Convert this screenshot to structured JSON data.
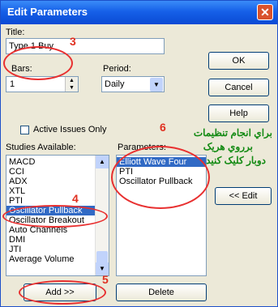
{
  "window": {
    "title": "Edit Parameters",
    "close_glyph": "✕"
  },
  "labels": {
    "title": "Title:",
    "bars": "Bars:",
    "period": "Period:",
    "active_issues": "Active Issues Only",
    "studies_available": "Studies Available:",
    "parameters": "Parameters:"
  },
  "fields": {
    "title_value": "Type 1 Buy",
    "bars_value": "1",
    "period_value": "Daily"
  },
  "buttons": {
    "ok": "OK",
    "cancel": "Cancel",
    "help": "Help",
    "edit": "<< Edit",
    "add": "Add >>",
    "delete": "Delete"
  },
  "studies": [
    "MACD",
    "CCI",
    "ADX",
    "XTL",
    "PTI",
    "Oscillator Pullback",
    "Oscillator Breakout",
    "Auto Channels",
    "DMI",
    "JTI",
    "Average Volume"
  ],
  "parameters": [
    "Elliott Wave Four",
    "PTI",
    "Oscillator Pullback"
  ],
  "annotations": {
    "n3": "3",
    "n4": "4",
    "n5": "5",
    "n6": "6",
    "line1": "براي انجام تنظيمات",
    "line2": "برروي هريک",
    "line3": "دوبار کليک کنيد",
    "color_ring": "#e83030",
    "color_note": "#138a13"
  }
}
